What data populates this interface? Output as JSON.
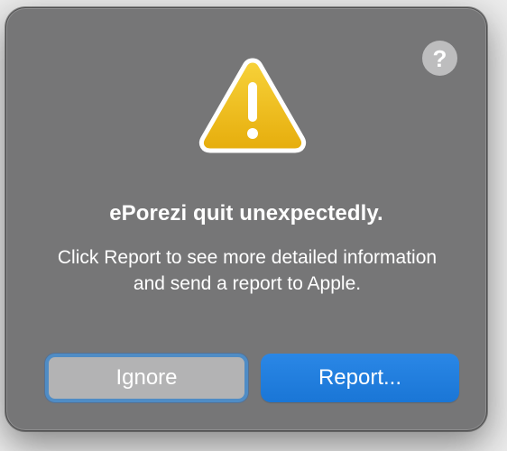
{
  "dialog": {
    "help_label": "?",
    "title": "ePorezi quit unexpectedly.",
    "message": "Click Report to see more detailed information and send a report to Apple.",
    "icon": "warning-triangle-icon",
    "buttons": {
      "ignore_label": "Ignore",
      "report_label": "Report..."
    }
  },
  "colors": {
    "dialog_background": "#767677",
    "primary_button": "#1a76d6",
    "secondary_button": "#b3b3b4",
    "focus_ring": "#4f8cc5",
    "warning_yellow": "#f2c21b"
  }
}
